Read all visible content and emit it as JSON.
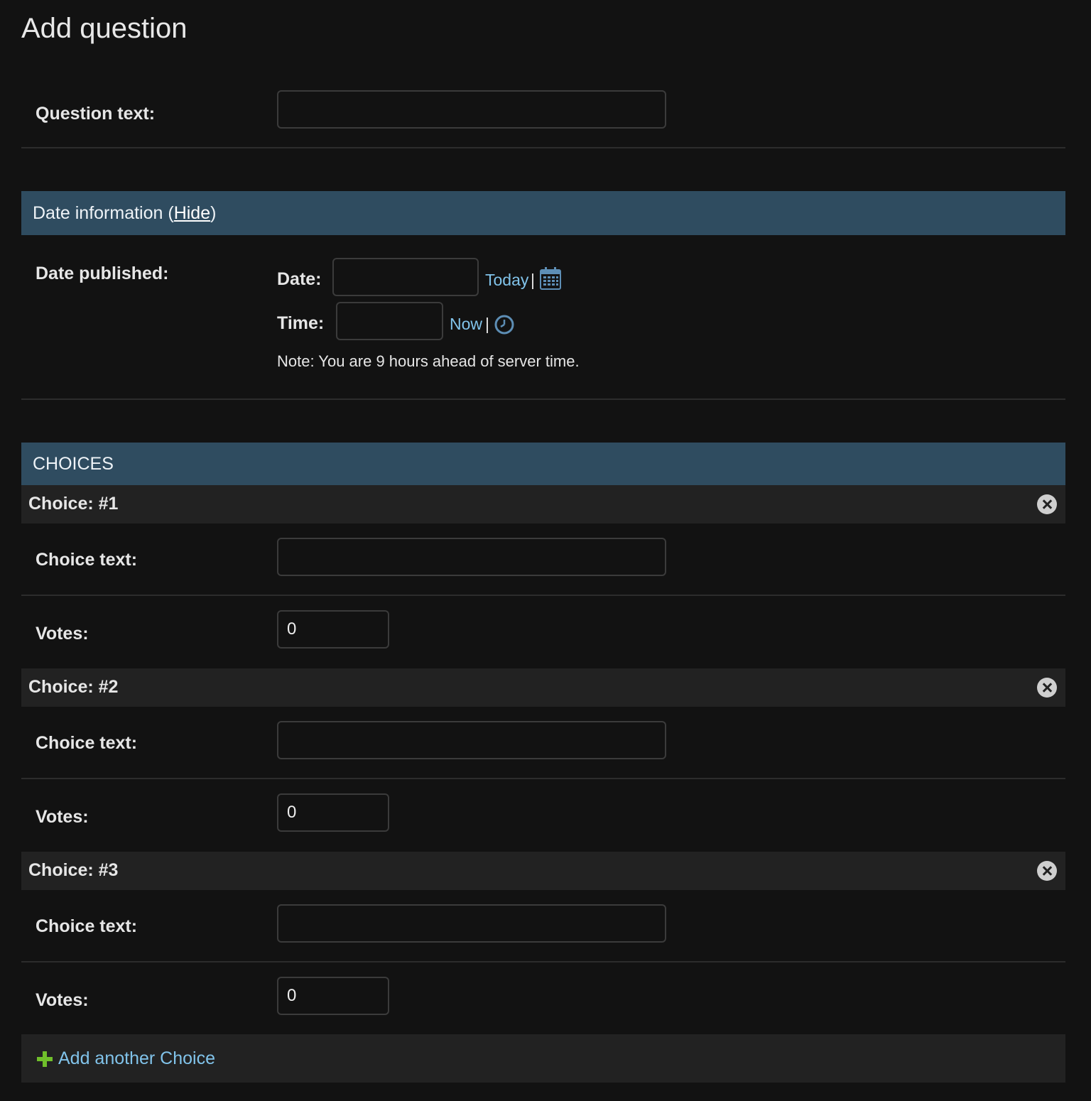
{
  "page": {
    "title": "Add question"
  },
  "question_text": {
    "label": "Question text:",
    "value": ""
  },
  "date_section": {
    "title_prefix": "Date information (",
    "hide_link": "Hide",
    "title_suffix": ")",
    "field_label": "Date published:",
    "date": {
      "label": "Date:",
      "value": "",
      "shortcut": "Today",
      "separator": "|",
      "icon": "calendar-icon"
    },
    "time": {
      "label": "Time:",
      "value": "",
      "shortcut": "Now",
      "separator": "|",
      "icon": "clock-icon"
    },
    "timezone_note": "Note: You are 9 hours ahead of server time."
  },
  "choices_section": {
    "title": "CHOICES",
    "choices": [
      {
        "title": "Choice: #1",
        "text_label": "Choice text:",
        "text_value": "",
        "votes_label": "Votes:",
        "votes_value": "0"
      },
      {
        "title": "Choice: #2",
        "text_label": "Choice text:",
        "text_value": "",
        "votes_label": "Votes:",
        "votes_value": "0"
      },
      {
        "title": "Choice: #3",
        "text_label": "Choice text:",
        "text_value": "",
        "votes_label": "Votes:",
        "votes_value": "0"
      }
    ],
    "add_another": "Add another Choice"
  },
  "colors": {
    "background": "#121212",
    "section_header": "#2f4c60",
    "inline_header": "#222222",
    "link": "#81c3ea",
    "add_icon": "#70bf2b"
  }
}
